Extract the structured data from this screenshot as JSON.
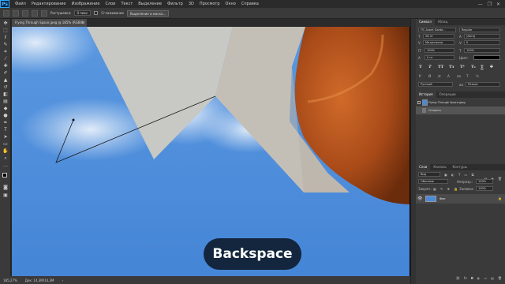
{
  "app": {
    "logo": "Ps",
    "menu": [
      "Файл",
      "Редактирование",
      "Изображение",
      "Слои",
      "Текст",
      "Выделение",
      "Фильтр",
      "3D",
      "Просмотр",
      "Окно",
      "Справка"
    ],
    "window_controls": [
      "—",
      "❐",
      "✕"
    ]
  },
  "options_bar": {
    "feather_label": "Растушевка:",
    "feather_value": "0 пикс.",
    "antialias_label": "Сглаживание",
    "select_mask_label": "Выделение и маска..."
  },
  "tools": [
    "move-icon",
    "marquee-icon",
    "lasso-icon",
    "quick-select-icon",
    "crop-icon",
    "eyedropper-icon",
    "healing-icon",
    "brush-icon",
    "stamp-icon",
    "history-brush-icon",
    "eraser-icon",
    "gradient-icon",
    "blur-icon",
    "dodge-icon",
    "pen-icon",
    "type-icon",
    "path-select-icon",
    "shape-icon",
    "hand-icon",
    "zoom-icon",
    "more-icon"
  ],
  "document": {
    "tab_title": "Flying Through Space.jpeg @ 185% (RGB/8)",
    "close": "×"
  },
  "status": {
    "zoom": "185,27%",
    "doc_info": "Док: 14,3M/14,3M"
  },
  "caption": "Backspace",
  "character_panel": {
    "tabs": [
      "Символ",
      "Абзац"
    ],
    "font_family": "ITC Avant Garde...",
    "font_style": "Regular",
    "font_size": "26 пт",
    "leading": "(Авто)",
    "kerning": "Метрически",
    "tracking": "0",
    "vscale": "100%",
    "hscale": "100%",
    "baseline": "0 пт",
    "color_label": "Цвет:",
    "type_buttons": [
      "T",
      "T",
      "TT",
      "Tт",
      "T¹",
      "T₁",
      "T",
      "T"
    ],
    "language": "Русский",
    "aa": "aa",
    "aa_mode": "Резкое"
  },
  "history_panel": {
    "tabs": [
      "История",
      "Операции"
    ],
    "snapshot": "Flying Through Space.jpeg",
    "step": "Открыть"
  },
  "layers_panel": {
    "tabs": [
      "Слои",
      "Каналы",
      "Контуры"
    ],
    "kind_label": "Вид",
    "blend_mode": "Обычные",
    "opacity_label": "Непрозр.:",
    "opacity": "100%",
    "lock_label": "Закреп.:",
    "fill_label": "Заливка:",
    "fill": "100%",
    "layer_name": "Фон"
  },
  "colors": {
    "sky": "#4a8ad8",
    "caption_bg": "#13263d",
    "accent": "#31a8ff"
  }
}
